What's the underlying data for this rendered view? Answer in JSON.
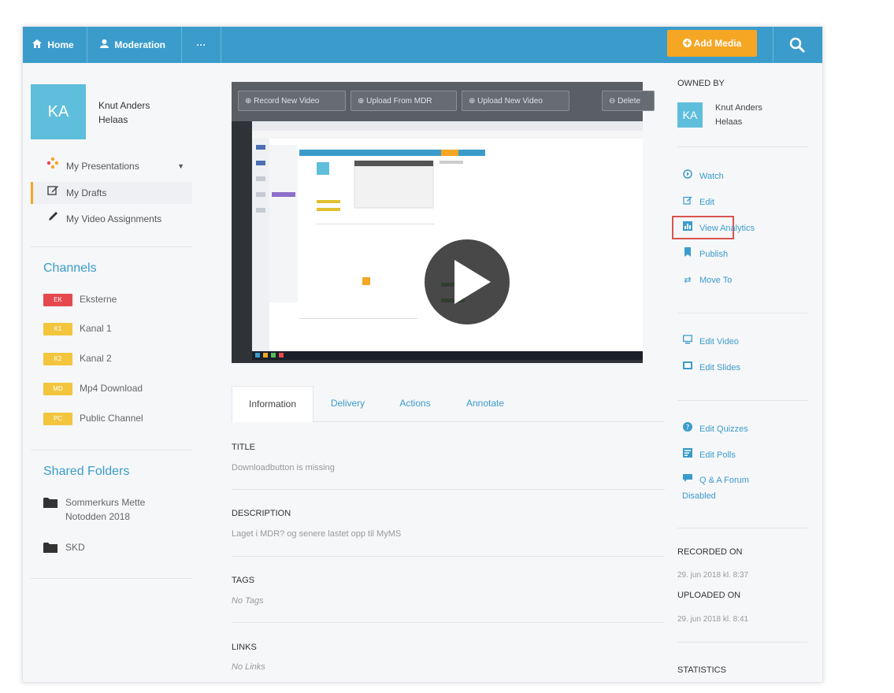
{
  "topbar": {
    "home_label": "Home",
    "moderation_label": "Moderation",
    "more_label": "···",
    "add_media_label": "Add Media",
    "bar_color": "#3b9ccb",
    "accent_color": "#f5a623"
  },
  "user": {
    "initials": "KA",
    "name_line1": "Knut Anders",
    "name_line2": "Helaas"
  },
  "sidebar": {
    "items": [
      {
        "label": "My Presentations",
        "icon": "presentations-icon"
      },
      {
        "label": "My Drafts",
        "icon": "edit-icon"
      },
      {
        "label": "My Video Assignments",
        "icon": "pencil-icon"
      }
    ],
    "channels_title": "Channels",
    "channels": [
      {
        "badge": "EK",
        "label": "Eksterne",
        "color": "#e5484d"
      },
      {
        "badge": "K1",
        "label": "Kanal 1",
        "color": "#f2c53d"
      },
      {
        "badge": "K2",
        "label": "Kanal 2",
        "color": "#f2c53d"
      },
      {
        "badge": "MD",
        "label": "Mp4 Download",
        "color": "#f2c53d"
      },
      {
        "badge": "PC",
        "label": "Public Channel",
        "color": "#f2c53d"
      }
    ],
    "folders_title": "Shared Folders",
    "folders": [
      {
        "line1": "Sommerkurs Mette",
        "line2": "Notodden 2018"
      },
      {
        "line1": "SKD",
        "line2": ""
      }
    ]
  },
  "video": {
    "btn_record": "Record New Video",
    "btn_upload_mdr": "Upload From MDR",
    "btn_upload_new": "Upload New Video",
    "btn_delete": "Delete"
  },
  "tabs": [
    {
      "label": "Information"
    },
    {
      "label": "Delivery"
    },
    {
      "label": "Actions"
    },
    {
      "label": "Annotate"
    }
  ],
  "info": {
    "title_label": "TITLE",
    "title_value": "Downloadbutton is missing",
    "description_label": "DESCRIPTION",
    "description_value": "Laget i MDR? og senere lastet opp til MyMS",
    "tags_label": "TAGS",
    "tags_value": "No Tags",
    "links_label": "LINKS",
    "links_value": "No Links"
  },
  "right": {
    "owned_by_label": "OWNED BY",
    "owner_initials": "KA",
    "owner_line1": "Knut Anders",
    "owner_line2": "Helaas",
    "actions": [
      {
        "label": "Watch",
        "icon": "play-circle-icon"
      },
      {
        "label": "Edit",
        "icon": "edit-icon"
      },
      {
        "label": "View Analytics",
        "icon": "analytics-icon"
      },
      {
        "label": "Publish",
        "icon": "publish-icon"
      },
      {
        "label": "Move To",
        "icon": "move-icon"
      }
    ],
    "edit_actions": [
      {
        "label": "Edit Video",
        "icon": "monitor-icon"
      },
      {
        "label": "Edit Slides",
        "icon": "slides-icon"
      }
    ],
    "quiz_actions": [
      {
        "label": "Edit Quizzes",
        "icon": "question-icon"
      },
      {
        "label": "Edit Polls",
        "icon": "polls-icon"
      },
      {
        "label": "Q & A Forum",
        "icon": "forum-icon"
      }
    ],
    "forum_status": "Disabled",
    "recorded_label": "RECORDED ON",
    "recorded_value": "29. jun 2018 kl. 8:37",
    "uploaded_label": "UPLOADED ON",
    "uploaded_value": "29. jun 2018 kl. 8:41",
    "statistics_label": "STATISTICS",
    "highlight_color": "#d9534f"
  }
}
